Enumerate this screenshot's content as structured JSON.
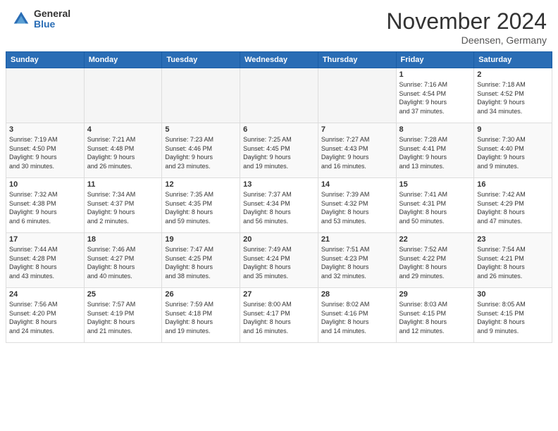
{
  "logo": {
    "general": "General",
    "blue": "Blue"
  },
  "header": {
    "month": "November 2024",
    "location": "Deensen, Germany"
  },
  "days_of_week": [
    "Sunday",
    "Monday",
    "Tuesday",
    "Wednesday",
    "Thursday",
    "Friday",
    "Saturday"
  ],
  "weeks": [
    [
      {
        "day": "",
        "info": ""
      },
      {
        "day": "",
        "info": ""
      },
      {
        "day": "",
        "info": ""
      },
      {
        "day": "",
        "info": ""
      },
      {
        "day": "",
        "info": ""
      },
      {
        "day": "1",
        "info": "Sunrise: 7:16 AM\nSunset: 4:54 PM\nDaylight: 9 hours\nand 37 minutes."
      },
      {
        "day": "2",
        "info": "Sunrise: 7:18 AM\nSunset: 4:52 PM\nDaylight: 9 hours\nand 34 minutes."
      }
    ],
    [
      {
        "day": "3",
        "info": "Sunrise: 7:19 AM\nSunset: 4:50 PM\nDaylight: 9 hours\nand 30 minutes."
      },
      {
        "day": "4",
        "info": "Sunrise: 7:21 AM\nSunset: 4:48 PM\nDaylight: 9 hours\nand 26 minutes."
      },
      {
        "day": "5",
        "info": "Sunrise: 7:23 AM\nSunset: 4:46 PM\nDaylight: 9 hours\nand 23 minutes."
      },
      {
        "day": "6",
        "info": "Sunrise: 7:25 AM\nSunset: 4:45 PM\nDaylight: 9 hours\nand 19 minutes."
      },
      {
        "day": "7",
        "info": "Sunrise: 7:27 AM\nSunset: 4:43 PM\nDaylight: 9 hours\nand 16 minutes."
      },
      {
        "day": "8",
        "info": "Sunrise: 7:28 AM\nSunset: 4:41 PM\nDaylight: 9 hours\nand 13 minutes."
      },
      {
        "day": "9",
        "info": "Sunrise: 7:30 AM\nSunset: 4:40 PM\nDaylight: 9 hours\nand 9 minutes."
      }
    ],
    [
      {
        "day": "10",
        "info": "Sunrise: 7:32 AM\nSunset: 4:38 PM\nDaylight: 9 hours\nand 6 minutes."
      },
      {
        "day": "11",
        "info": "Sunrise: 7:34 AM\nSunset: 4:37 PM\nDaylight: 9 hours\nand 2 minutes."
      },
      {
        "day": "12",
        "info": "Sunrise: 7:35 AM\nSunset: 4:35 PM\nDaylight: 8 hours\nand 59 minutes."
      },
      {
        "day": "13",
        "info": "Sunrise: 7:37 AM\nSunset: 4:34 PM\nDaylight: 8 hours\nand 56 minutes."
      },
      {
        "day": "14",
        "info": "Sunrise: 7:39 AM\nSunset: 4:32 PM\nDaylight: 8 hours\nand 53 minutes."
      },
      {
        "day": "15",
        "info": "Sunrise: 7:41 AM\nSunset: 4:31 PM\nDaylight: 8 hours\nand 50 minutes."
      },
      {
        "day": "16",
        "info": "Sunrise: 7:42 AM\nSunset: 4:29 PM\nDaylight: 8 hours\nand 47 minutes."
      }
    ],
    [
      {
        "day": "17",
        "info": "Sunrise: 7:44 AM\nSunset: 4:28 PM\nDaylight: 8 hours\nand 43 minutes."
      },
      {
        "day": "18",
        "info": "Sunrise: 7:46 AM\nSunset: 4:27 PM\nDaylight: 8 hours\nand 40 minutes."
      },
      {
        "day": "19",
        "info": "Sunrise: 7:47 AM\nSunset: 4:25 PM\nDaylight: 8 hours\nand 38 minutes."
      },
      {
        "day": "20",
        "info": "Sunrise: 7:49 AM\nSunset: 4:24 PM\nDaylight: 8 hours\nand 35 minutes."
      },
      {
        "day": "21",
        "info": "Sunrise: 7:51 AM\nSunset: 4:23 PM\nDaylight: 8 hours\nand 32 minutes."
      },
      {
        "day": "22",
        "info": "Sunrise: 7:52 AM\nSunset: 4:22 PM\nDaylight: 8 hours\nand 29 minutes."
      },
      {
        "day": "23",
        "info": "Sunrise: 7:54 AM\nSunset: 4:21 PM\nDaylight: 8 hours\nand 26 minutes."
      }
    ],
    [
      {
        "day": "24",
        "info": "Sunrise: 7:56 AM\nSunset: 4:20 PM\nDaylight: 8 hours\nand 24 minutes."
      },
      {
        "day": "25",
        "info": "Sunrise: 7:57 AM\nSunset: 4:19 PM\nDaylight: 8 hours\nand 21 minutes."
      },
      {
        "day": "26",
        "info": "Sunrise: 7:59 AM\nSunset: 4:18 PM\nDaylight: 8 hours\nand 19 minutes."
      },
      {
        "day": "27",
        "info": "Sunrise: 8:00 AM\nSunset: 4:17 PM\nDaylight: 8 hours\nand 16 minutes."
      },
      {
        "day": "28",
        "info": "Sunrise: 8:02 AM\nSunset: 4:16 PM\nDaylight: 8 hours\nand 14 minutes."
      },
      {
        "day": "29",
        "info": "Sunrise: 8:03 AM\nSunset: 4:15 PM\nDaylight: 8 hours\nand 12 minutes."
      },
      {
        "day": "30",
        "info": "Sunrise: 8:05 AM\nSunset: 4:15 PM\nDaylight: 8 hours\nand 9 minutes."
      }
    ]
  ]
}
